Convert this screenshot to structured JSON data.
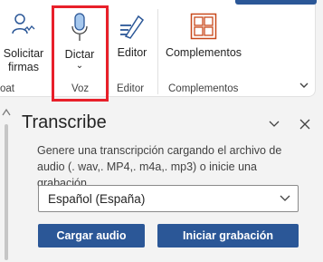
{
  "ribbon": {
    "solicitar_label_1": "Solicitar",
    "solicitar_label_2": "firmas",
    "dictar_label": "Dictar",
    "dictar_caret": "⌄",
    "editor_label": "Editor",
    "complementos_label": "Complementos",
    "group_partial": "oat",
    "group_voz": "Voz",
    "group_editor": "Editor",
    "group_complementos": "Complementos",
    "accent_color": "#2b5797",
    "highlight_color": "#e8202a"
  },
  "pane": {
    "title": "Transcribe",
    "description": "Genere una transcripción cargando el archivo de audio (. wav,. MP4,. m4a,. mp3) o inicie una grabación.",
    "language_value": "Español (España)",
    "upload_button": "Cargar audio",
    "record_button": "Iniciar grabación"
  }
}
